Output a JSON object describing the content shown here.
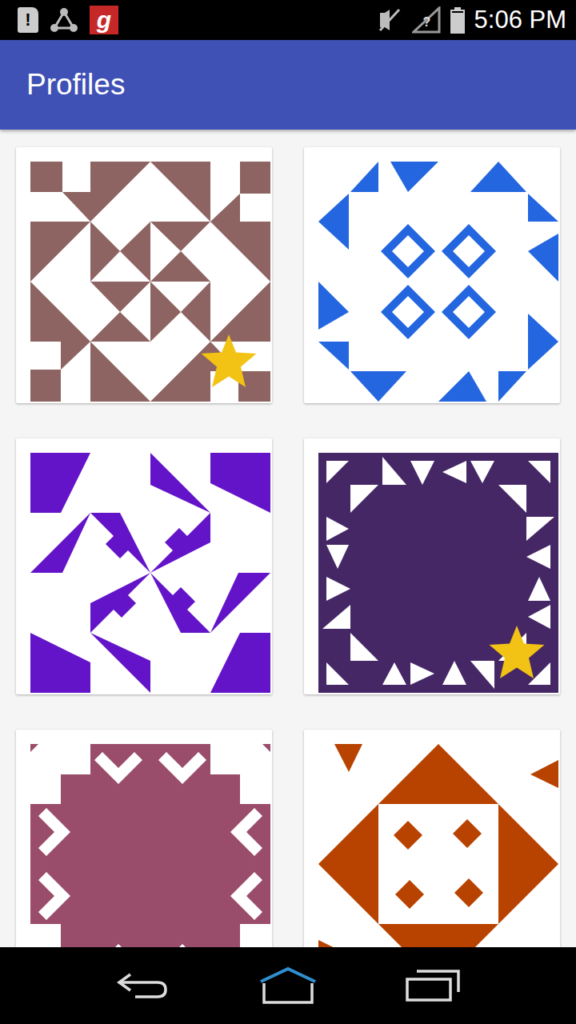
{
  "status_bar": {
    "notifications": [
      {
        "kind": "alert",
        "glyph": "!"
      },
      {
        "kind": "network"
      },
      {
        "kind": "app",
        "glyph": "g"
      }
    ],
    "sound_muted": true,
    "signal_glyph": "?",
    "battery_level": 0.9,
    "time": "5:06 PM"
  },
  "app_bar": {
    "title": "Profiles"
  },
  "profiles": [
    {
      "kind": "star-burst",
      "color": "#8d6461",
      "starred": true
    },
    {
      "kind": "pinwheel",
      "color": "#2366e0",
      "starred": false
    },
    {
      "kind": "compass",
      "color": "#6414c8",
      "starred": false
    },
    {
      "kind": "triangles",
      "color": "#452766",
      "starred": true
    },
    {
      "kind": "cross",
      "color": "#9a4d6b",
      "starred": false
    },
    {
      "kind": "frame",
      "color": "#b84300",
      "starred": false
    }
  ]
}
